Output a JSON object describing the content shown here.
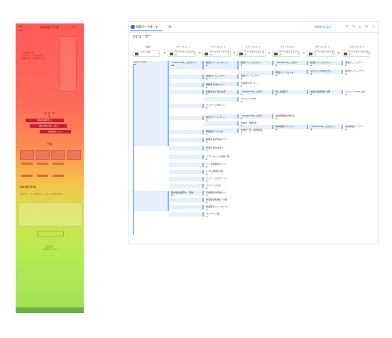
{
  "phone": {
    "logo": "KOVECTIN",
    "cart_label": "9件",
    "hero_lines": [
      "今日の夢心の肌",
      "に合わせた、お肌の悩みを",
      "最適化基準・最高品質ケアを。"
    ],
    "pills": [
      "美容液 乾燥肌オイル",
      "化粧水を使う前に 一度に",
      "美容液肌をシュール"
    ],
    "dots": "● ● ● ●",
    "section_title": "特集",
    "brand2": "KOVECTIN",
    "tagline": "肌を守り、キメ細やかに。美しさを保ちます。",
    "bottom_text_1": "会社概要",
    "bottom_text_2": "COMPANY INFO"
  },
  "panel": {
    "tab_label": "経路データ探...",
    "tab_add": "+",
    "link_text": "変更を元に戻す",
    "icons": [
      "undo-icon",
      "redo-icon",
      "download-icon",
      "share-icon",
      "check-icon"
    ],
    "report_title": "CVユーザー",
    "columns": [
      {
        "title": "始点",
        "value": "イベント名"
      },
      {
        "title": "ステップ+1",
        "value": "ページ タイトルとスク..."
      },
      {
        "title": "ステップ+2",
        "value": "ページ タイトルとスク..."
      },
      {
        "title": "ステップ+3",
        "value": "ページ タイトルとスク..."
      },
      {
        "title": "ステップ+4",
        "value": "ページ タイトルとスク..."
      },
      {
        "title": "ステップ+5",
        "value": "ページ タイトルとスク..."
      },
      {
        "title": "ステップ+6",
        "value": "ページ タイトルとスク..."
      }
    ],
    "root": {
      "label": "session_start",
      "value": "51"
    },
    "nodes": [
      {
        "col": 1,
        "row": 0,
        "label": "「KOVECTIN」公式サイト...",
        "value": "11"
      },
      {
        "col": 1,
        "row": 1,
        "label": "顔の悩み(肌荒れ・乾燥...",
        "value": "2"
      },
      {
        "col": 2,
        "row": 0,
        "label": "保湿クリーム(スキンケ...",
        "value": "4"
      },
      {
        "col": 2,
        "row": 1,
        "label": "保湿クリーム アウ...",
        "value": "2"
      },
      {
        "col": 2,
        "row": 2,
        "label": "美容液 基本セット...",
        "value": "2"
      },
      {
        "col": 2,
        "row": 3,
        "label": "化粧水など 肌のお手...",
        "value": "2"
      },
      {
        "col": 2,
        "row": 4,
        "label": "マイページTOP (公...",
        "value": "1"
      },
      {
        "col": 2,
        "row": 5,
        "label": "保湿クリーム アレ...",
        "value": "1"
      },
      {
        "col": 2,
        "row": 6,
        "label": "美容液(オイル 他...",
        "value": "1"
      },
      {
        "col": 2,
        "row": 7,
        "label": "美容液 肌の悩みアプ...",
        "value": "1"
      },
      {
        "col": 2,
        "row": 8,
        "label": "保湿系 肌のお手入...",
        "value": "1"
      },
      {
        "col": 2,
        "row": 9,
        "label": "プラントレット商品一覧...",
        "value": "1"
      },
      {
        "col": 2,
        "row": 10,
        "label": "ケース保湿用のアプ...",
        "value": "1"
      },
      {
        "col": 2,
        "row": 11,
        "label": "ニキビ(肌荒れ)保...",
        "value": "1"
      },
      {
        "col": 2,
        "row": 12,
        "label": "マイページログイン...",
        "value": "1"
      },
      {
        "col": 2,
        "row": 13,
        "label": "マイページTOP",
        "value": "1"
      },
      {
        "col": 2,
        "row": 14,
        "label": "乾燥肌用の乾燥から...",
        "value": "1"
      },
      {
        "col": 2,
        "row": 15,
        "label": "保湿肌を乾燥性「お肌...",
        "value": "1"
      },
      {
        "col": 2,
        "row": 16,
        "label": "保湿用オイル スキンケ...",
        "value": "1"
      },
      {
        "col": 2,
        "row": 17,
        "label": "マイページ 他",
        "value": "1"
      },
      {
        "col": 3,
        "row": 0,
        "label": "保湿クリーム(スキン...",
        "value": "3"
      },
      {
        "col": 3,
        "row": 1,
        "label": "保湿クリーム アウ...",
        "value": "2"
      },
      {
        "col": 3,
        "row": 2,
        "label": "お客様サポート...",
        "value": "1"
      },
      {
        "col": 3,
        "row": 3,
        "label": "「KOVECTIN」公式サ...",
        "value": "2"
      },
      {
        "col": 3,
        "row": 4,
        "label": "マイページTOP",
        "value": "1"
      },
      {
        "col": 3,
        "row": 5,
        "label": "「KOVECTIN」公式サ...",
        "value": "2"
      },
      {
        "col": 3,
        "row": 6,
        "label": "化粧水・保湿 肌...",
        "value": "1"
      },
      {
        "col": 3,
        "row": 7,
        "label": "化粧水一覧・保湿乾燥...",
        "value": "1"
      },
      {
        "col": 4,
        "row": 0,
        "label": "「KOVECTIN」公式サ...",
        "value": "2"
      },
      {
        "col": 4,
        "row": 1,
        "label": "保湿クリーム(スキ...",
        "value": "1"
      },
      {
        "col": 4,
        "row": 2,
        "label": "購入処理完了",
        "value": "1"
      },
      {
        "col": 4,
        "row": 3,
        "label": "会員登録時の申込み...",
        "value": "1"
      },
      {
        "col": 4,
        "row": 4,
        "label": "本体保湿ケア クリ...",
        "value": "1"
      },
      {
        "col": 5,
        "row": 0,
        "label": "保湿クリーム(スキン...",
        "value": "1"
      },
      {
        "col": 5,
        "row": 1,
        "label": "マイページTOP(公式...",
        "value": "1"
      },
      {
        "col": 5,
        "row": 2,
        "label": "会員の会員登録 お問...",
        "value": "1"
      },
      {
        "col": 5,
        "row": 3,
        "label": "「KOVECTIN」公式サイ...",
        "value": "1"
      },
      {
        "col": 6,
        "row": 0,
        "label": "保湿クリーム アレ...",
        "value": "1"
      },
      {
        "col": 6,
        "row": 1,
        "label": "保湿クリーム アウ...",
        "value": "1"
      },
      {
        "col": 6,
        "row": 2,
        "label": "マイページTOP 公式...",
        "value": "1"
      },
      {
        "col": 6,
        "row": 3,
        "label": "本体保湿ケア アレ...",
        "value": "1"
      }
    ]
  }
}
